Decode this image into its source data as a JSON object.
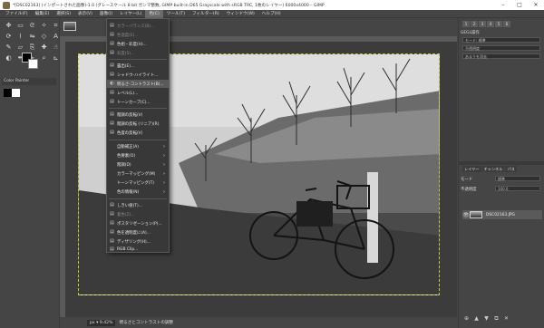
{
  "window": {
    "title": "*[DSC02163] (インポートされた画像)-1.0 (グレースケール 8 bit ガンマ整数, GIMP built-in D65 Grayscale with sRGB TRC, 1枚のレイヤー) 6000x4000 – GIMP",
    "minimize": "–",
    "maximize": "□",
    "close": "✕"
  },
  "menubar": [
    "ファイル(F)",
    "編集(E)",
    "選択(S)",
    "表示(V)",
    "画像(I)",
    "レイヤー(L)",
    "色(C)",
    "ツール(T)",
    "フィルター(R)",
    "ウィンドウ(W)",
    "ヘルプ(H)"
  ],
  "active_menu": "色(C)",
  "colors_menu": {
    "items": [
      {
        "label": "カラーバランス(B)...",
        "disabled": true,
        "icon": "color-balance-icon"
      },
      {
        "label": "色温度(E)...",
        "disabled": true,
        "icon": "color-temperature-icon"
      },
      {
        "label": "色相・彩度(H)...",
        "disabled": false,
        "icon": "hue-saturation-icon"
      },
      {
        "label": "彩度(S)...",
        "disabled": true,
        "icon": "saturation-icon"
      },
      {
        "label": "露出(E)...",
        "disabled": false,
        "icon": "exposure-icon"
      },
      {
        "label": "シャドウ-ハイライト...",
        "disabled": false,
        "icon": "shadows-highlights-icon"
      },
      {
        "label": "明るさ-コントラスト(B)...",
        "disabled": false,
        "icon": "brightness-contrast-icon",
        "highlight": true
      },
      {
        "label": "レベル(L)...",
        "disabled": false,
        "icon": "levels-icon"
      },
      {
        "label": "トーンカーブ(C)...",
        "disabled": false,
        "icon": "curves-icon"
      },
      {
        "label": "階調の反転(V)",
        "disabled": false,
        "icon": "invert-icon"
      },
      {
        "label": "階調の反転 (リニア)(R)",
        "disabled": false,
        "icon": "linear-invert-icon"
      },
      {
        "label": "色度の反転(V)",
        "disabled": false,
        "icon": "value-invert-icon"
      },
      {
        "label": "自動補正(A)",
        "disabled": false,
        "submenu": true
      },
      {
        "label": "色要素(O)",
        "disabled": false,
        "submenu": true
      },
      {
        "label": "階調(D)",
        "disabled": false,
        "submenu": true
      },
      {
        "label": "カラーマッピング(M)",
        "disabled": false,
        "submenu": true
      },
      {
        "label": "トーンマッピング(T)",
        "disabled": false,
        "submenu": true
      },
      {
        "label": "色の情報(N)",
        "disabled": false,
        "submenu": true
      },
      {
        "label": "しきい値(T)...",
        "disabled": false,
        "icon": "threshold-icon"
      },
      {
        "label": "着色(Z)...",
        "disabled": true,
        "icon": "colorize-icon"
      },
      {
        "label": "ポスタリゼーション(P)...",
        "disabled": false,
        "icon": "posterize-icon"
      },
      {
        "label": "色を透明度に(A)...",
        "disabled": false,
        "icon": "color-to-alpha-icon"
      },
      {
        "label": "ディザリング(H)...",
        "disabled": false,
        "icon": "dither-icon"
      },
      {
        "label": "RGB Clip...",
        "disabled": false,
        "icon": "rgb-clip-icon"
      },
      {
        "label": "ホットスポット...",
        "disabled": true,
        "icon": "hot-spot-icon"
      }
    ]
  },
  "toolbox": {
    "panel_title": "Color Painter",
    "tools": [
      "move-icon",
      "rect-select-icon",
      "lasso-icon",
      "fuzzy-select-icon",
      "crop-icon",
      "rotate-icon",
      "warp-icon",
      "flip-icon",
      "cage-icon",
      "text-icon",
      "paintbrush-icon",
      "eraser-icon",
      "clone-icon",
      "heal-icon",
      "smudge-icon",
      "dodge-icon",
      "path-icon",
      "picker-icon",
      "zoom-icon",
      "measure-icon"
    ]
  },
  "dock": {
    "tab_labels": [
      "1",
      "2",
      "3",
      "4",
      "5",
      "6"
    ],
    "brush_label": "GEGL操作",
    "field1": "モード: 標準",
    "field2": "不透明度",
    "field3": "あまりを消去",
    "layers_tabs": [
      "レイヤー",
      "チャンネル",
      "パス"
    ],
    "mode_label": "モード",
    "mode_value": "標準",
    "opacity_label": "不透明度",
    "opacity_value": "100.0",
    "layer_name": "DSC02163.JPG",
    "eye": "👁"
  },
  "statusbar": {
    "zoom": "px ▾ 9.42%",
    "message": "明るさとコントラストの調整"
  }
}
